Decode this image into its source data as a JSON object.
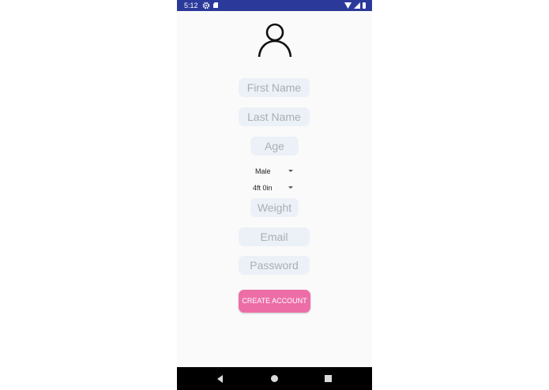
{
  "status_bar": {
    "time": "5:12",
    "icons": [
      "gear-icon",
      "sd-card-icon",
      "wifi-icon",
      "signal-icon",
      "battery-icon"
    ]
  },
  "form": {
    "avatar_icon": "person-icon",
    "first_name_placeholder": "First Name",
    "last_name_placeholder": "Last Name",
    "age_placeholder": "Age",
    "gender_selected": "Male",
    "height_selected": "4ft 0in",
    "weight_placeholder": "Weight",
    "email_placeholder": "Email",
    "password_placeholder": "Password",
    "create_account_label": "CREATE ACCOUNT"
  },
  "nav_bar": {
    "icons": [
      "back-icon",
      "home-icon",
      "recents-icon"
    ]
  },
  "colors": {
    "status_bar": "#2b3a9a",
    "field_background": "#ecf1f8",
    "placeholder_text": "#a9aeb6",
    "button": "#ed6ea7",
    "background": "#fafafa"
  }
}
